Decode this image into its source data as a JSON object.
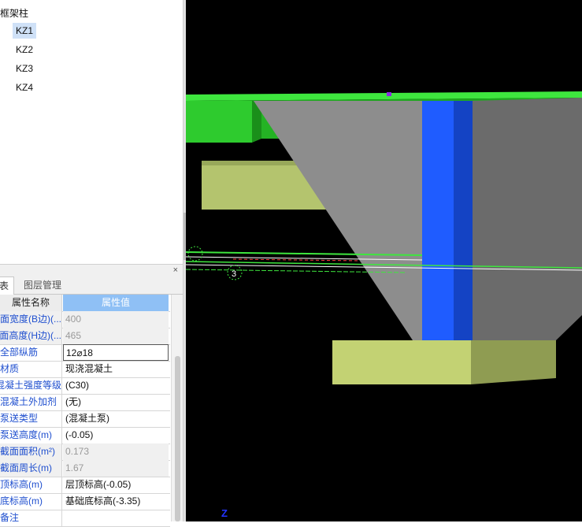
{
  "tree": {
    "root_label": "框架柱",
    "items": [
      {
        "label": "KZ1",
        "selected": true
      },
      {
        "label": "KZ2",
        "selected": false
      },
      {
        "label": "KZ3",
        "selected": false
      },
      {
        "label": "KZ4",
        "selected": false
      }
    ]
  },
  "panel": {
    "close_glyph": "×",
    "tabs": [
      {
        "label": "表",
        "active": true
      },
      {
        "label": "图层管理",
        "active": false
      }
    ]
  },
  "grid": {
    "header_name": "属性名称",
    "header_value": "属性值",
    "rows": [
      {
        "name": "截面宽度(B边)(...",
        "value": "400",
        "readonly": true
      },
      {
        "name": "截面高度(H边)(...",
        "value": "465",
        "readonly": true
      },
      {
        "name": "全部纵筋",
        "value": "12⌀18",
        "editing": true
      },
      {
        "name": "材质",
        "value": "现浇混凝土"
      },
      {
        "name": "混凝土强度等级",
        "value": "(C30)"
      },
      {
        "name": "混凝土外加剂",
        "value": "(无)"
      },
      {
        "name": "泵送类型",
        "value": "(混凝土泵)"
      },
      {
        "name": "泵送高度(m)",
        "value": "(-0.05)"
      },
      {
        "name": "截面面积(m²)",
        "value": "0.173",
        "readonly": true
      },
      {
        "name": "截面周长(m)",
        "value": "1.67",
        "readonly": true
      },
      {
        "name": "顶标高(m)",
        "value": "层顶标高(-0.05)"
      },
      {
        "name": "底标高(m)",
        "value": "基础底标高(-3.35)"
      },
      {
        "name": "备注",
        "value": ""
      }
    ]
  },
  "viewport": {
    "axis_label": "Z",
    "grid_marker": "3",
    "colors": {
      "background": "#000000",
      "slab_green": "#2fcf2f",
      "beam_olive": "#b3c46e",
      "footing_gray": "#8a8a8a",
      "column_blue": "#1e5bff",
      "footing_base": "#c2d173"
    }
  }
}
